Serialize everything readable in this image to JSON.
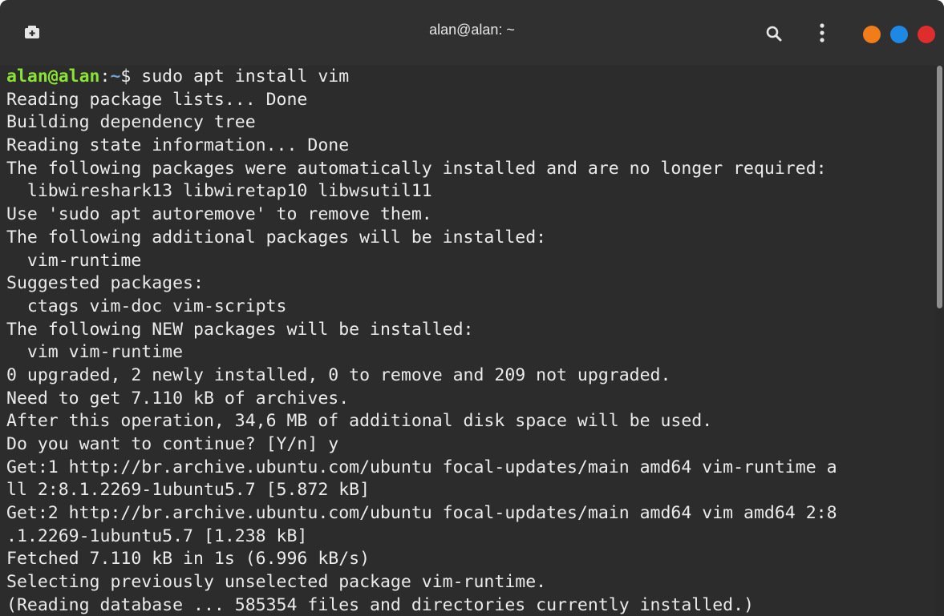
{
  "window": {
    "title": "alan@alan: ~"
  },
  "colors": {
    "titlebar": "#303030",
    "terminal_bg": "#2c2c2c",
    "text": "#ebebeb",
    "prompt_user": "#8ae234",
    "prompt_path": "#729fcf",
    "dot_minimize": "#f07d1a",
    "dot_maximize": "#1e88e5",
    "dot_close": "#df2c2c"
  },
  "icons": {
    "new_tab": "new-tab-icon",
    "search": "search-icon",
    "menu": "kebab-menu-icon"
  },
  "terminal": {
    "prompt": {
      "user": "alan@alan",
      "sep": ":",
      "path": "~",
      "symbol": "$ ",
      "command": "sudo apt install vim"
    },
    "output": [
      "Reading package lists... Done",
      "Building dependency tree",
      "Reading state information... Done",
      "The following packages were automatically installed and are no longer required:",
      "  libwireshark13 libwiretap10 libwsutil11",
      "Use 'sudo apt autoremove' to remove them.",
      "The following additional packages will be installed:",
      "  vim-runtime",
      "Suggested packages:",
      "  ctags vim-doc vim-scripts",
      "The following NEW packages will be installed:",
      "  vim vim-runtime",
      "0 upgraded, 2 newly installed, 0 to remove and 209 not upgraded.",
      "Need to get 7.110 kB of archives.",
      "After this operation, 34,6 MB of additional disk space will be used.",
      "Do you want to continue? [Y/n] y",
      "Get:1 http://br.archive.ubuntu.com/ubuntu focal-updates/main amd64 vim-runtime a",
      "ll 2:8.1.2269-1ubuntu5.7 [5.872 kB]",
      "Get:2 http://br.archive.ubuntu.com/ubuntu focal-updates/main amd64 vim amd64 2:8",
      ".1.2269-1ubuntu5.7 [1.238 kB]",
      "Fetched 7.110 kB in 1s (6.996 kB/s)",
      "Selecting previously unselected package vim-runtime.",
      "(Reading database ... 585354 files and directories currently installed.)"
    ]
  }
}
